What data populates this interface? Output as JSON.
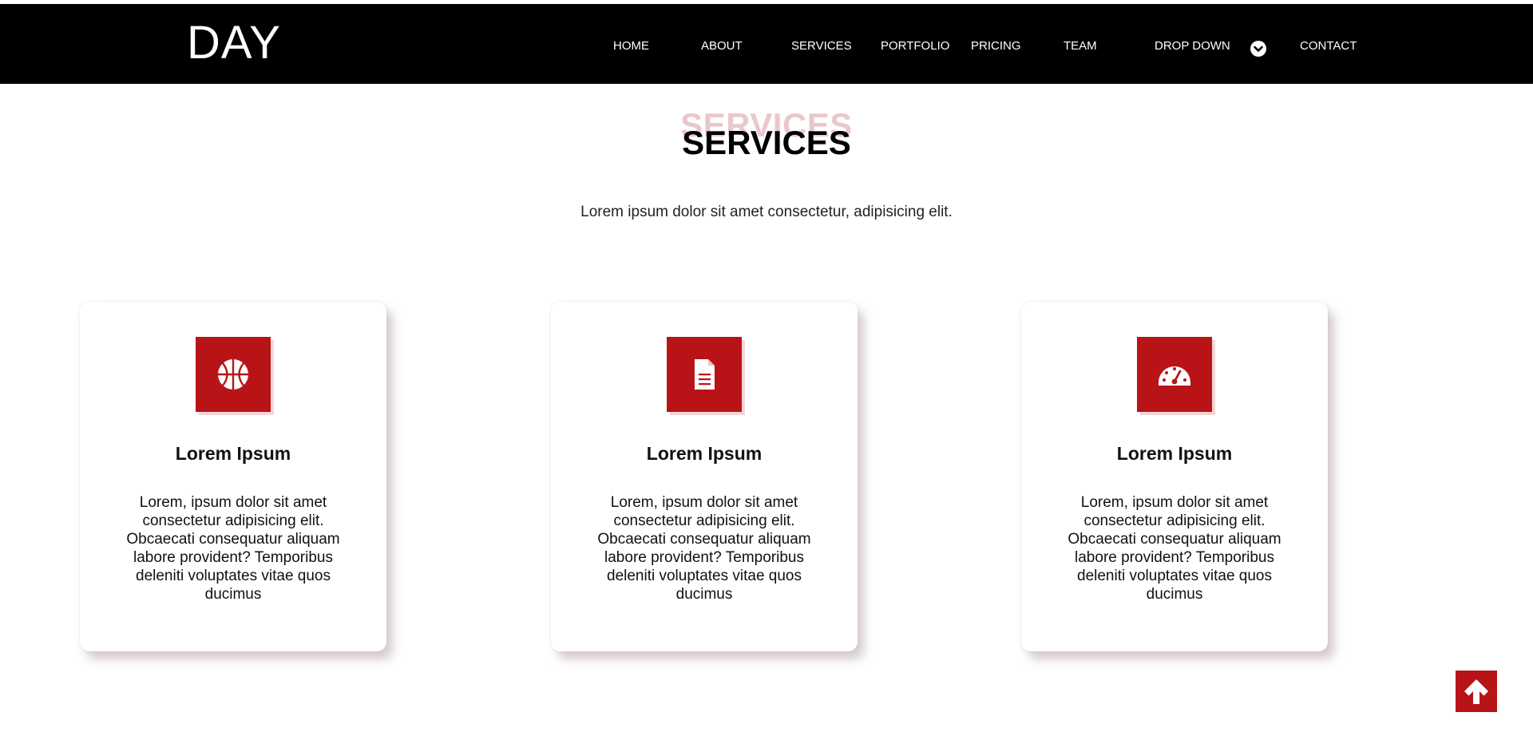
{
  "brand": "DAY",
  "nav": {
    "items": [
      {
        "label": "HOME"
      },
      {
        "label": "ABOUT"
      },
      {
        "label": "SERVICES"
      },
      {
        "label": "PORTFOLIO"
      },
      {
        "label": "PRICING"
      },
      {
        "label": "TEAM"
      },
      {
        "label": "DROP DOWN"
      },
      {
        "label": "CONTACT"
      }
    ],
    "dropdown_icon": "chevron-circle-down-icon"
  },
  "section": {
    "bg_title": "SERVICES",
    "title": "SERVICES",
    "subtitle": "Lorem ipsum dolor sit amet consectetur, adipisicing elit."
  },
  "cards": [
    {
      "icon": "basketball-icon",
      "title": "Lorem Ipsum",
      "text": "Lorem, ipsum dolor sit amet consectetur adipisicing elit. Obcaecati consequatur aliquam labore provident? Temporibus deleniti voluptates vitae quos ducimus"
    },
    {
      "icon": "document-icon",
      "title": "Lorem Ipsum",
      "text": "Lorem, ipsum dolor sit amet consectetur adipisicing elit. Obcaecati consequatur aliquam labore provident? Temporibus deleniti voluptates vitae quos ducimus"
    },
    {
      "icon": "speedometer-icon",
      "title": "Lorem Ipsum",
      "text": "Lorem, ipsum dolor sit amet consectetur adipisicing elit. Obcaecati consequatur aliquam labore provident? Temporibus deleniti voluptates vitae quos ducimus"
    }
  ],
  "scroll_top_icon": "arrow-up-icon",
  "colors": {
    "accent": "#b81418",
    "navbar_bg": "#000000",
    "bg_title": "#e9c7cb"
  }
}
